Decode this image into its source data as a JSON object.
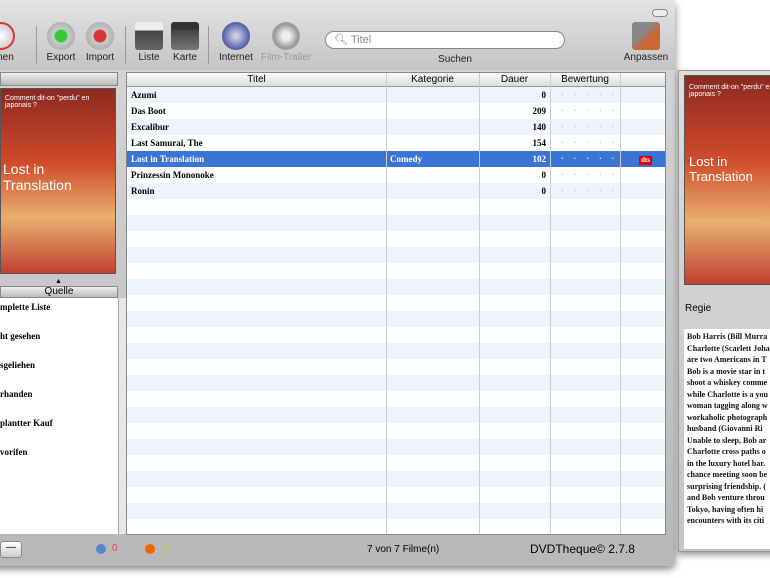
{
  "toolbar": {
    "items": [
      {
        "label": "ernen",
        "icon": "remove-dvd-icon"
      },
      {
        "label": "Export",
        "icon": "export-icon"
      },
      {
        "label": "Import",
        "icon": "import-icon"
      },
      {
        "label": "Liste",
        "icon": "print-list-icon"
      },
      {
        "label": "Karte",
        "icon": "print-card-icon"
      },
      {
        "label": "Internet",
        "icon": "globe-icon"
      },
      {
        "label": "Film-Trailer",
        "icon": "film-reel-icon"
      },
      {
        "label": "Anpassen",
        "icon": "customize-icon"
      }
    ],
    "search_placeholder": "Titel",
    "search_label": "Suchen"
  },
  "sources": {
    "header": "Quelle",
    "items": [
      "mplette Liste",
      "ht gesehen",
      "sgeliehen",
      "rhanden",
      "plantter Kauf",
      "vorifen"
    ]
  },
  "poster": {
    "tagline": "Comment dit-on \"perdu\" en japonais ?",
    "title": "Lost in Translation"
  },
  "table": {
    "columns": [
      "Titel",
      "Kategorie",
      "Dauer",
      "Bewertung",
      ""
    ],
    "rows": [
      {
        "title": "Azumi",
        "category": "",
        "duration": "0",
        "rating": "· · · · ·",
        "extra": ""
      },
      {
        "title": "Das Boot",
        "category": "",
        "duration": "209",
        "rating": "· · · · ·",
        "extra": ""
      },
      {
        "title": "Excalibur",
        "category": "",
        "duration": "140",
        "rating": "· · · · ·",
        "extra": ""
      },
      {
        "title": "Last Samurai, The",
        "category": "",
        "duration": "154",
        "rating": "· · · · ·",
        "extra": ""
      },
      {
        "title": "Lost in Translation",
        "category": "Comedy",
        "duration": "102",
        "rating": "· · · · ·",
        "extra": "dts"
      },
      {
        "title": "Prinzessin Mononoke",
        "category": "",
        "duration": "0",
        "rating": "· · · · ·",
        "extra": ""
      },
      {
        "title": "Ronin",
        "category": "",
        "duration": "0",
        "rating": "· · · · ·",
        "extra": ""
      }
    ],
    "selected": 4
  },
  "status": {
    "count1": "0",
    "count2": "0",
    "summary": "7 von 7 Filme(n)",
    "app": "DVDTheque© 2.7.8",
    "minus": "—"
  },
  "drawer": {
    "label": "Regie",
    "description": [
      "Bob Harris (Bill Murra",
      "Charlotte (Scarlett Joha",
      "are two Americans in T",
      "Bob is a movie star in t",
      "shoot a whiskey comme",
      "while Charlotte is a you",
      "woman tagging along w",
      "workaholic photograph",
      "husband (Giovanni Ri",
      "Unable to sleep, Bob ar",
      "Charlotte cross paths o",
      "in the luxury hotel bar.",
      "chance meeting soon be",
      "surprising friendship. (",
      "and Bob venture throu",
      "Tokyo, having often hi",
      "encounters with its citi"
    ]
  }
}
